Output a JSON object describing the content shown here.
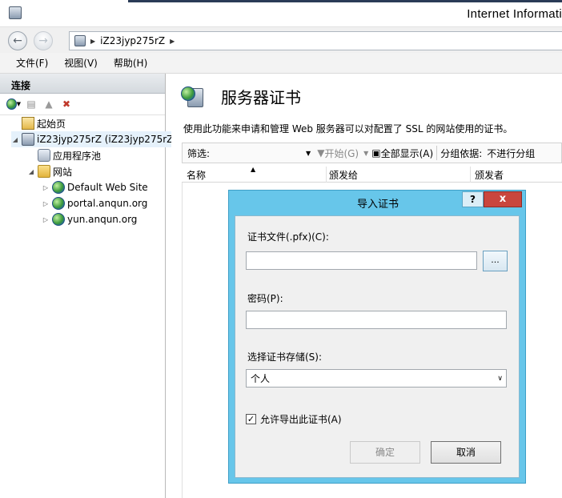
{
  "window": {
    "title": "Internet Informati"
  },
  "address": {
    "path": "iZ23jyp275rZ"
  },
  "menu": {
    "items": [
      "文件(F)",
      "视图(V)",
      "帮助(H)"
    ]
  },
  "connections": {
    "header": "连接",
    "tree": [
      {
        "label": "起始页",
        "icon": "home-icon"
      },
      {
        "label": "iZ23jyp275rZ (iZ23jyp275rZ",
        "icon": "server-icon"
      },
      {
        "label": "应用程序池",
        "icon": "app-pool-icon"
      },
      {
        "label": "网站",
        "icon": "folder-icon"
      },
      {
        "label": "Default Web Site",
        "icon": "globe-icon"
      },
      {
        "label": "portal.anqun.org",
        "icon": "globe-icon"
      },
      {
        "label": "yun.anqun.org",
        "icon": "globe-icon"
      }
    ]
  },
  "main": {
    "title": "服务器证书",
    "description": "使用此功能来申请和管理 Web 服务器可以对配置了 SSL 的网站使用的证书。",
    "filter": {
      "label": "筛选:",
      "start": "开始(G)",
      "show_all": "全部显示(A)",
      "group_by_label": "分组依据:",
      "group_by_value": "不进行分组"
    },
    "columns": [
      "名称",
      "颁发给",
      "颁发者"
    ]
  },
  "dialog": {
    "title": "导入证书",
    "help": "?",
    "close": "x",
    "file_label": "证书文件(.pfx)(C):",
    "file_value": "",
    "browse": "...",
    "password_label": "密码(P):",
    "password_value": "",
    "store_label": "选择证书存储(S):",
    "store_value": "个人",
    "allow_export_label": "允许导出此证书(A)",
    "allow_export_checked": true,
    "ok": "确定",
    "cancel": "取消"
  }
}
